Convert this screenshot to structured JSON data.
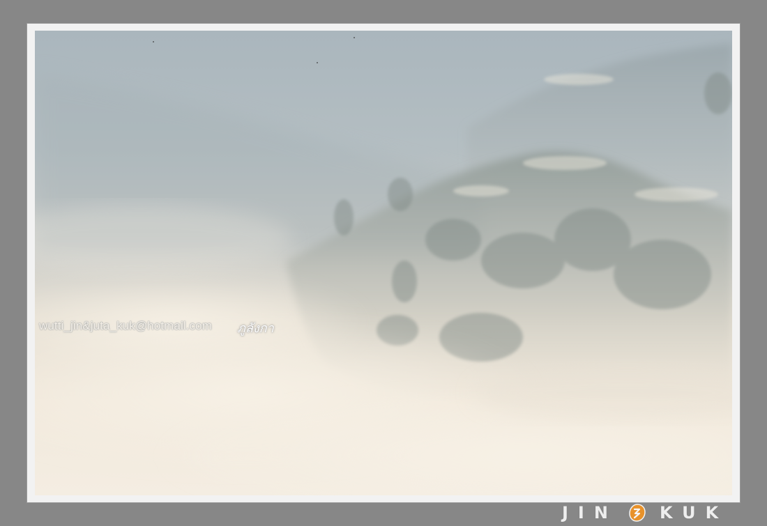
{
  "watermark": {
    "email": "wutti_jin&juta_kuk@hotmail.com",
    "place": "ภูลังกา"
  },
  "logo": {
    "left_word": "JIN",
    "right_word": "KUK",
    "mark_color": "#e8922a"
  },
  "colors": {
    "background": "#878787",
    "frame": "#f2f2f2",
    "sky": "#aab6bd",
    "fog": "#f4ede2"
  }
}
